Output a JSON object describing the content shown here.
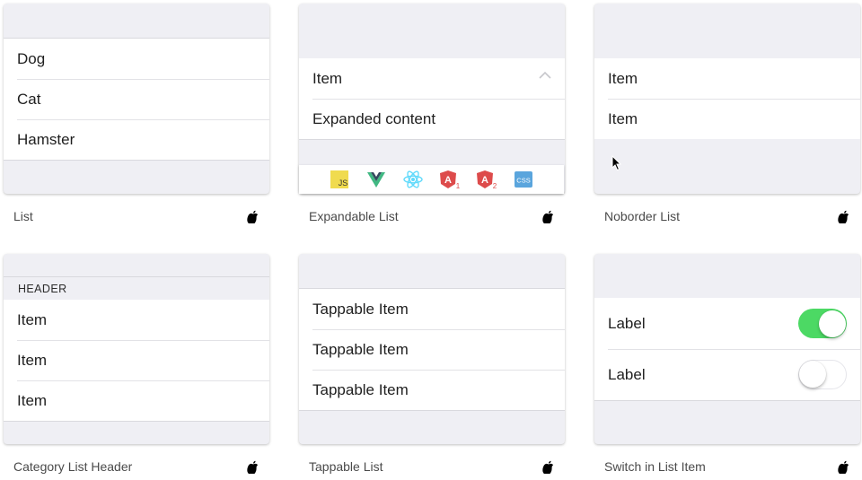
{
  "cards": [
    {
      "caption": "List",
      "platform_icon": "apple-icon",
      "items": [
        "Dog",
        "Cat",
        "Hamster"
      ]
    },
    {
      "caption": "Expandable List",
      "platform_icon": "apple-icon",
      "item": "Item",
      "expanded_content": "Expanded content",
      "expand_icon": "chevron-up-icon"
    },
    {
      "caption": "Noborder List",
      "platform_icon": "apple-icon",
      "items": [
        "Item",
        "Item"
      ]
    },
    {
      "caption": "Category List Header",
      "platform_icon": "apple-icon",
      "header": "HEADER",
      "items": [
        "Item",
        "Item",
        "Item"
      ]
    },
    {
      "caption": "Tappable List",
      "platform_icon": "apple-icon",
      "items": [
        "Tappable Item",
        "Tappable Item",
        "Tappable Item"
      ]
    },
    {
      "caption": "Switch in List Item",
      "platform_icon": "apple-icon",
      "items": [
        {
          "label": "Label",
          "checked": true
        },
        {
          "label": "Label",
          "checked": false
        }
      ]
    }
  ],
  "framework_bar": {
    "icons": [
      {
        "name": "javascript-icon",
        "text": "JS",
        "color": "#f0db4f"
      },
      {
        "name": "vue-icon",
        "color": "#41b883"
      },
      {
        "name": "react-icon",
        "color": "#61dafb"
      },
      {
        "name": "angular1-icon",
        "text": "A",
        "sub": "1",
        "color": "#dd4b4b"
      },
      {
        "name": "angular2-icon",
        "text": "A",
        "sub": "2",
        "color": "#dd4b4b"
      },
      {
        "name": "css-icon",
        "text": "CSS",
        "color": "#5aa5dd"
      }
    ]
  },
  "colors": {
    "switch_on": "#4cd964",
    "group_background": "#efeff4"
  }
}
